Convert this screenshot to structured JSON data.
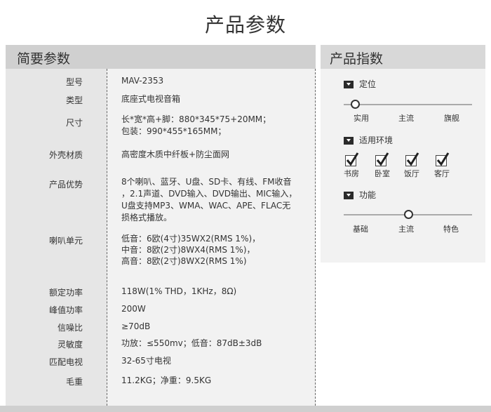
{
  "page_title": "产品参数",
  "summary": {
    "title": "简要参数",
    "rows": [
      {
        "label": "型号",
        "value": [
          "MAV-2353"
        ]
      },
      {
        "label": "类型",
        "value": [
          "底座式电视音箱"
        ]
      },
      {
        "label": "尺寸",
        "value": [
          "长*宽*高+脚：880*345*75+20MM；",
          "包装：990*455*165MM；"
        ]
      },
      {
        "label": "外壳材质",
        "value": [
          "高密度木质中纤板+防尘面网"
        ]
      },
      {
        "label": "产品优势",
        "value": [
          "8个喇叭、蓝牙、U盘、SD卡、有线、FM收音",
          "，2.1声道、DVD输入、DVD输出、MIC输入，",
          "U盘支持MP3、WMA、WAC、APE、FLAC无",
          "损格式播放。"
        ]
      },
      {
        "label": "喇叭单元",
        "value": [
          "低音：6欧(4寸)35WX2(RMS 1%)，",
          "中音：8欧(2寸)8WX4(RMS 1%)，",
          "高音：8欧(2寸)8WX2(RMS 1%)"
        ]
      },
      {
        "label": "额定功率",
        "value": [
          "118W(1% THD，1KHz，8Ω)"
        ]
      },
      {
        "label": "峰值功率",
        "value": [
          "200W"
        ]
      },
      {
        "label": "信噪比",
        "value": [
          "≥70dB"
        ]
      },
      {
        "label": "灵敏度",
        "value": [
          "功放：≤550mv；低音：87dB±3dB"
        ]
      },
      {
        "label": "匹配电视",
        "value": [
          "32-65寸电视"
        ]
      },
      {
        "label": "毛重",
        "value": [
          "11.2KG；净重：9.5KG"
        ]
      }
    ]
  },
  "index": {
    "title": "产品指数",
    "positioning": {
      "title": "定位",
      "ticks": [
        "实用",
        "主流",
        "旗舰"
      ],
      "selected_index": 0,
      "level": 0.09
    },
    "environment": {
      "title": "适用环境",
      "items": [
        {
          "label": "书房",
          "checked": true
        },
        {
          "label": "卧室",
          "checked": true
        },
        {
          "label": "饭厅",
          "checked": true
        },
        {
          "label": "客厅",
          "checked": true
        }
      ]
    },
    "function": {
      "title": "功能",
      "ticks": [
        "基础",
        "主流",
        "特色"
      ],
      "selected_index": 1,
      "level": 0.5
    }
  }
}
